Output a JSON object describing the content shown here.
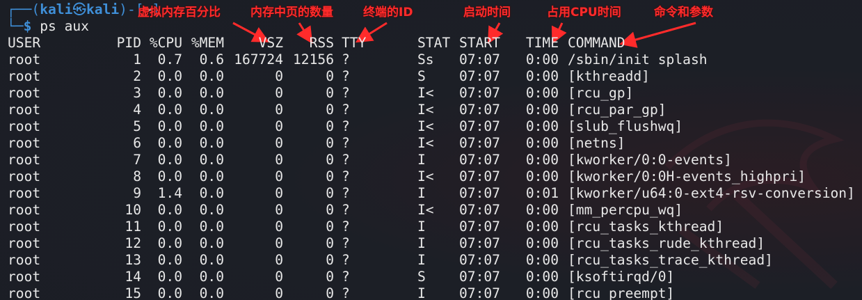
{
  "prompt": {
    "frame_top": "┌──(",
    "user": "kali",
    "skull": "㉿",
    "host": "kali",
    "close_paren": ")-[",
    "dir": "~",
    "close_bracket": "]",
    "frame_bottom": "└─",
    "dollar": "$",
    "command": "ps aux"
  },
  "annotations": {
    "vsz": "虚拟内存百分比",
    "rss": "内存中页的数量",
    "tty": "终端的ID",
    "start": "启动时间",
    "time": "占用CPU时间",
    "command": "命令和参数",
    "color": "#ff2b2b"
  },
  "table": {
    "headers": {
      "user": "USER",
      "pid": "PID",
      "cpu": "%CPU",
      "mem": "%MEM",
      "vsz": "VSZ",
      "rss": "RSS",
      "tty": "TTY",
      "stat": "STAT",
      "start": "START",
      "time": "TIME",
      "command": "COMMAND"
    },
    "rows": [
      {
        "user": "root",
        "pid": "1",
        "cpu": "0.7",
        "mem": "0.6",
        "vsz": "167724",
        "rss": "12156",
        "tty": "?",
        "stat": "Ss",
        "start": "07:07",
        "time": "0:00",
        "command": "/sbin/init splash"
      },
      {
        "user": "root",
        "pid": "2",
        "cpu": "0.0",
        "mem": "0.0",
        "vsz": "0",
        "rss": "0",
        "tty": "?",
        "stat": "S",
        "start": "07:07",
        "time": "0:00",
        "command": "[kthreadd]"
      },
      {
        "user": "root",
        "pid": "3",
        "cpu": "0.0",
        "mem": "0.0",
        "vsz": "0",
        "rss": "0",
        "tty": "?",
        "stat": "I<",
        "start": "07:07",
        "time": "0:00",
        "command": "[rcu_gp]"
      },
      {
        "user": "root",
        "pid": "4",
        "cpu": "0.0",
        "mem": "0.0",
        "vsz": "0",
        "rss": "0",
        "tty": "?",
        "stat": "I<",
        "start": "07:07",
        "time": "0:00",
        "command": "[rcu_par_gp]"
      },
      {
        "user": "root",
        "pid": "5",
        "cpu": "0.0",
        "mem": "0.0",
        "vsz": "0",
        "rss": "0",
        "tty": "?",
        "stat": "I<",
        "start": "07:07",
        "time": "0:00",
        "command": "[slub_flushwq]"
      },
      {
        "user": "root",
        "pid": "6",
        "cpu": "0.0",
        "mem": "0.0",
        "vsz": "0",
        "rss": "0",
        "tty": "?",
        "stat": "I<",
        "start": "07:07",
        "time": "0:00",
        "command": "[netns]"
      },
      {
        "user": "root",
        "pid": "7",
        "cpu": "0.0",
        "mem": "0.0",
        "vsz": "0",
        "rss": "0",
        "tty": "?",
        "stat": "I",
        "start": "07:07",
        "time": "0:00",
        "command": "[kworker/0:0-events]"
      },
      {
        "user": "root",
        "pid": "8",
        "cpu": "0.0",
        "mem": "0.0",
        "vsz": "0",
        "rss": "0",
        "tty": "?",
        "stat": "I<",
        "start": "07:07",
        "time": "0:00",
        "command": "[kworker/0:0H-events_highpri]"
      },
      {
        "user": "root",
        "pid": "9",
        "cpu": "1.4",
        "mem": "0.0",
        "vsz": "0",
        "rss": "0",
        "tty": "?",
        "stat": "I",
        "start": "07:07",
        "time": "0:01",
        "command": "[kworker/u64:0-ext4-rsv-conversion]"
      },
      {
        "user": "root",
        "pid": "10",
        "cpu": "0.0",
        "mem": "0.0",
        "vsz": "0",
        "rss": "0",
        "tty": "?",
        "stat": "I<",
        "start": "07:07",
        "time": "0:00",
        "command": "[mm_percpu_wq]"
      },
      {
        "user": "root",
        "pid": "11",
        "cpu": "0.0",
        "mem": "0.0",
        "vsz": "0",
        "rss": "0",
        "tty": "?",
        "stat": "I",
        "start": "07:07",
        "time": "0:00",
        "command": "[rcu_tasks_kthread]"
      },
      {
        "user": "root",
        "pid": "12",
        "cpu": "0.0",
        "mem": "0.0",
        "vsz": "0",
        "rss": "0",
        "tty": "?",
        "stat": "I",
        "start": "07:07",
        "time": "0:00",
        "command": "[rcu_tasks_rude_kthread]"
      },
      {
        "user": "root",
        "pid": "13",
        "cpu": "0.0",
        "mem": "0.0",
        "vsz": "0",
        "rss": "0",
        "tty": "?",
        "stat": "I",
        "start": "07:07",
        "time": "0:00",
        "command": "[rcu_tasks_trace_kthread]"
      },
      {
        "user": "root",
        "pid": "14",
        "cpu": "0.0",
        "mem": "0.0",
        "vsz": "0",
        "rss": "0",
        "tty": "?",
        "stat": "S",
        "start": "07:07",
        "time": "0:00",
        "command": "[ksoftirqd/0]"
      },
      {
        "user": "root",
        "pid": "15",
        "cpu": "0.0",
        "mem": "0.0",
        "vsz": "0",
        "rss": "0",
        "tty": "?",
        "stat": "I",
        "start": "07:07",
        "time": "0:00",
        "command": "[rcu_preempt]"
      }
    ]
  }
}
